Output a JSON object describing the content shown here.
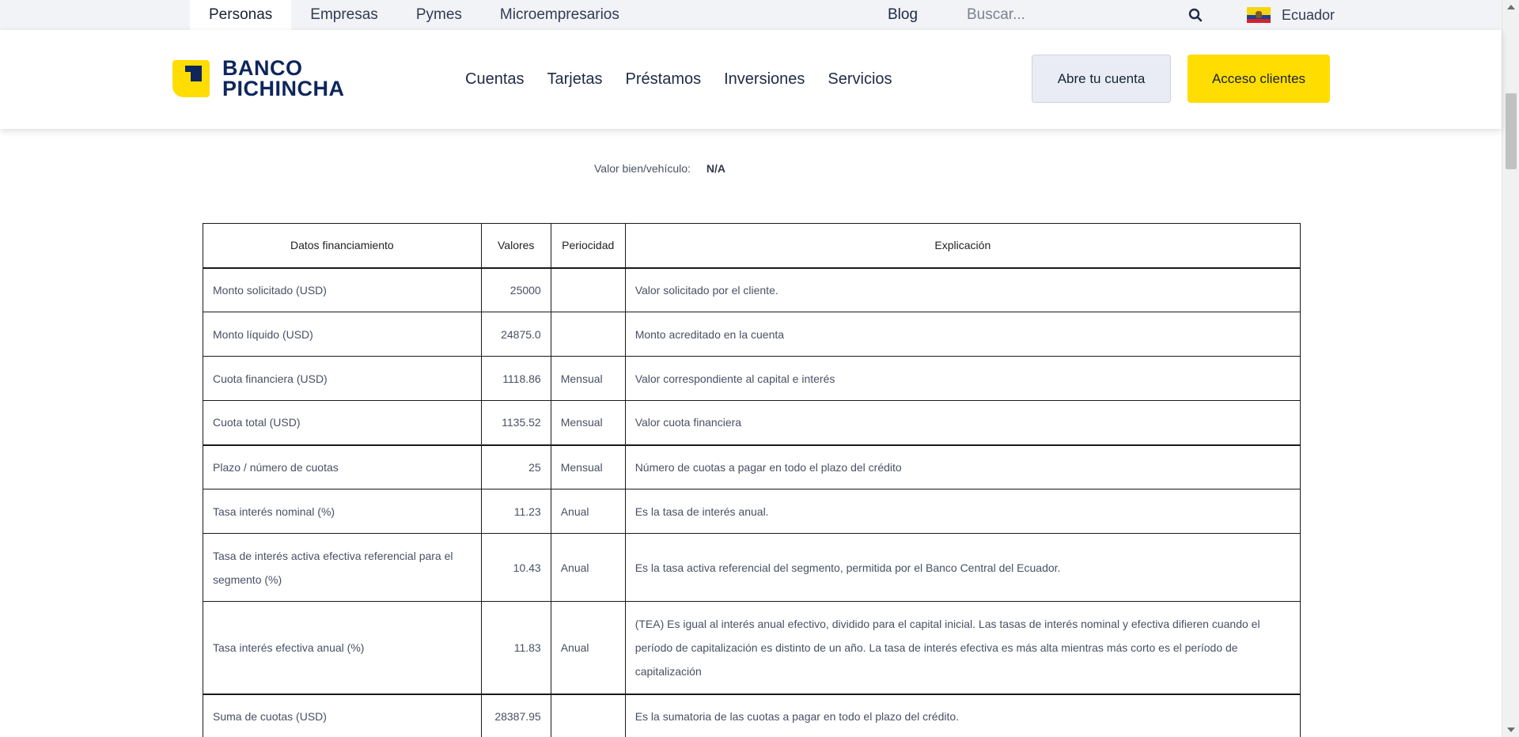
{
  "topbar": {
    "tabs": [
      {
        "label": "Personas",
        "active": true
      },
      {
        "label": "Empresas",
        "active": false
      },
      {
        "label": "Pymes",
        "active": false
      },
      {
        "label": "Microempresarios",
        "active": false
      }
    ],
    "blog": "Blog",
    "search_placeholder": "Buscar...",
    "country": "Ecuador"
  },
  "header": {
    "logo_line1": "BANCO",
    "logo_line2": "PICHINCHA",
    "nav": [
      "Cuentas",
      "Tarjetas",
      "Préstamos",
      "Inversiones",
      "Servicios"
    ],
    "open_account": "Abre tu cuenta",
    "client_access": "Acceso clientes"
  },
  "summary": {
    "valor_label": "Valor bien/vehículo:",
    "valor_value": "N/A"
  },
  "table": {
    "headers": [
      "Datos financiamiento",
      "Valores",
      "Periocidad",
      "Explicación"
    ],
    "rows": [
      {
        "dato": "Monto solicitado (USD)",
        "valor": "25000",
        "periodicidad": "",
        "explicacion": "Valor solicitado por el cliente."
      },
      {
        "dato": "Monto líquido (USD)",
        "valor": "24875.0",
        "periodicidad": "",
        "explicacion": "Monto acreditado en la cuenta"
      },
      {
        "dato": "Cuota financiera (USD)",
        "valor": "1118.86",
        "periodicidad": "Mensual",
        "explicacion": "Valor correspondiente al capital e interés"
      },
      {
        "dato": "Cuota total (USD)",
        "valor": "1135.52",
        "periodicidad": "Mensual",
        "explicacion": "Valor cuota financiera"
      },
      {
        "dato": "Plazo / número de cuotas",
        "valor": "25",
        "periodicidad": "Mensual",
        "explicacion": "Número de cuotas a pagar en todo el plazo del crédito"
      },
      {
        "dato": "Tasa interés nominal (%)",
        "valor": "11.23",
        "periodicidad": "Anual",
        "explicacion": "Es la tasa de interés anual."
      },
      {
        "dato": "Tasa de interés activa efectiva referencial para el segmento (%)",
        "valor": "10.43",
        "periodicidad": "Anual",
        "explicacion": "Es la tasa activa referencial del segmento, permitida por el Banco Central del Ecuador."
      },
      {
        "dato": "Tasa interés efectiva anual (%)",
        "valor": "11.83",
        "periodicidad": "Anual",
        "explicacion": "(TEA) Es igual al interés anual efectivo, dividido para el capital inicial. Las tasas de interés nominal y efectiva difieren cuando el período de capitalización es distinto de un año. La tasa de interés efectiva es más alta mientras más corto es el período de capitalización"
      },
      {
        "dato": "Suma de cuotas (USD)",
        "valor": "28387.95",
        "periodicidad": "",
        "explicacion": "Es la sumatoria de las cuotas a pagar en todo el plazo del crédito."
      }
    ]
  },
  "colors": {
    "brand_yellow": "#ffdd00",
    "brand_navy": "#0f265c",
    "topbar_bg": "#f2f3f7"
  }
}
